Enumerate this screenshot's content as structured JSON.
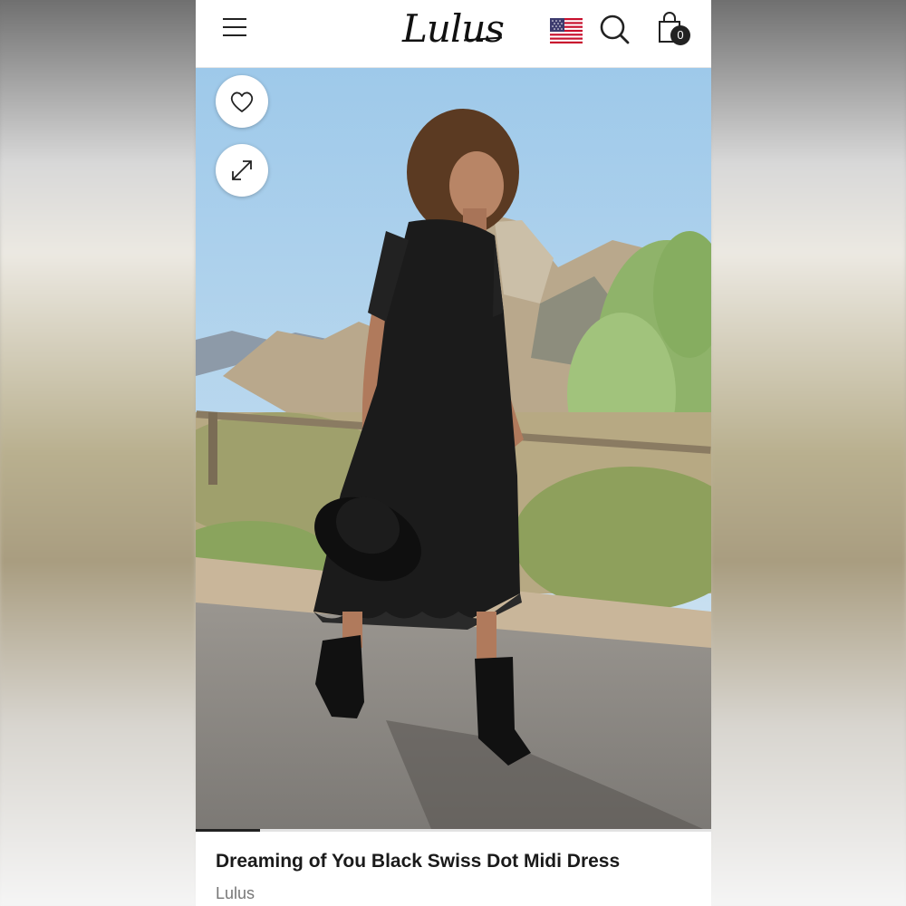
{
  "header": {
    "logo_text": "Lulus",
    "cart_count": "0",
    "icons": [
      "hamburger-menu-icon",
      "us-flag-icon",
      "search-icon",
      "shopping-bag-icon"
    ]
  },
  "gallery": {
    "progress_fraction": 0.125,
    "buttons": [
      "heart-icon",
      "expand-icon"
    ]
  },
  "product": {
    "title": "Dreaming of You Black Swiss Dot Midi Dress",
    "brand": "Lulus"
  },
  "colors": {
    "accent": "#222222",
    "sky": "#9ec9ea",
    "brand_gray": "#777777"
  }
}
